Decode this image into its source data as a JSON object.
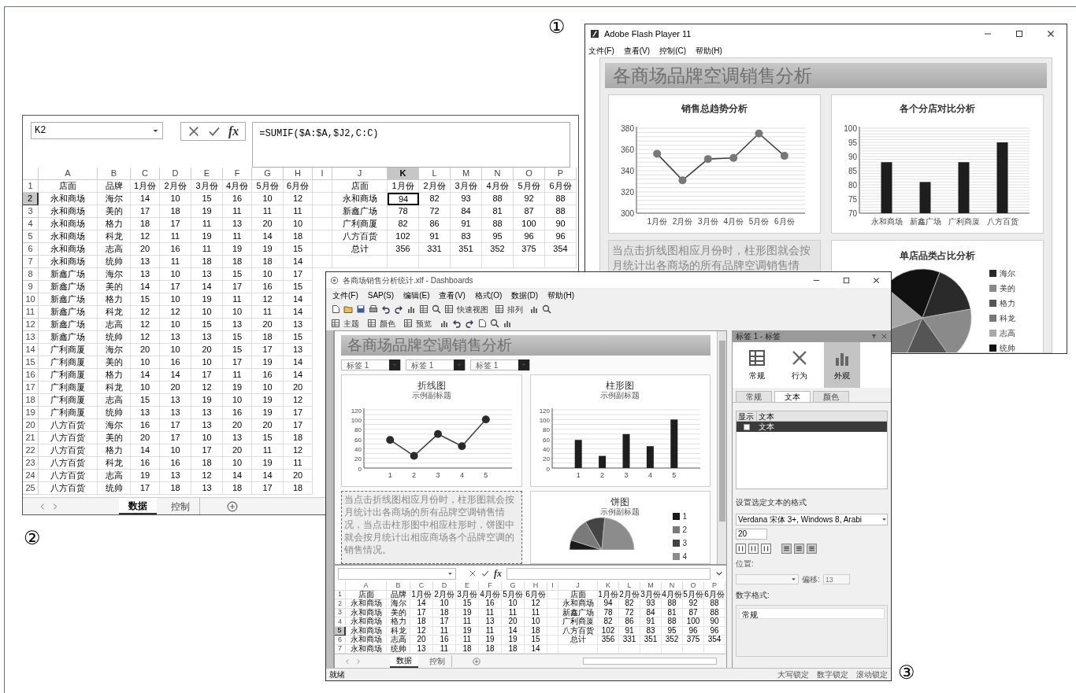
{
  "figure_labels": [
    "①",
    "②",
    "③"
  ],
  "flash_window": {
    "title": "Adobe Flash Player 11",
    "menu": [
      "文件(F)",
      "查看(V)",
      "控制(C)",
      "帮助(H)"
    ],
    "banner": "各商场品牌空调销售分析",
    "line_chart": {
      "chart_data": {
        "type": "line",
        "title": "销售总趋势分析",
        "categories": [
          "1月份",
          "2月份",
          "3月份",
          "4月份",
          "5月份",
          "6月份"
        ],
        "values": [
          356,
          331,
          351,
          352,
          375,
          354
        ],
        "grid": true,
        "marker": true,
        "ylim": [
          300,
          380
        ],
        "yticks": [
          300,
          320,
          340,
          360,
          380
        ]
      }
    },
    "bar_chart": {
      "chart_data": {
        "type": "bar",
        "title": "各个分店对比分析",
        "categories": [
          "永和商场",
          "新鑫广场",
          "广利商厦",
          "八方百货"
        ],
        "values": [
          88,
          81,
          88,
          95
        ],
        "grid": true,
        "ylim": [
          70,
          100
        ],
        "yticks": [
          70,
          75,
          80,
          85,
          90,
          95,
          100
        ]
      }
    },
    "description_lines": [
      "当点击折线图相应月份时，柱形图就会按",
      "月统计出各商场的所有品牌空调销售情"
    ],
    "pie_chart": {
      "title": "单店品类占比分析",
      "legend": [
        {
          "label": "海尔",
          "color": "#2a2a2a"
        },
        {
          "label": "美的",
          "color": "#8a8a8a"
        },
        {
          "label": "格力",
          "color": "#555555"
        },
        {
          "label": "科龙",
          "color": "#777777"
        },
        {
          "label": "志高",
          "color": "#a8a8a8"
        },
        {
          "label": "统帅",
          "color": "#111111"
        }
      ]
    }
  },
  "spreadsheet_window": {
    "name_box": "K2",
    "function_button": "fx",
    "formula": "=SUMIF($A:$A,$J2,C:C)",
    "columns": [
      {
        "label": "A",
        "selected": false
      },
      {
        "label": "B",
        "selected": false
      },
      {
        "label": "C",
        "selected": false
      },
      {
        "label": "D",
        "selected": false
      },
      {
        "label": "E",
        "selected": false
      },
      {
        "label": "F",
        "selected": false
      },
      {
        "label": "G",
        "selected": false
      },
      {
        "label": "H",
        "selected": false
      },
      {
        "label": "I",
        "selected": false
      },
      {
        "label": "J",
        "selected": false
      },
      {
        "label": "K",
        "selected": true
      },
      {
        "label": "L",
        "selected": false
      },
      {
        "label": "M",
        "selected": false
      },
      {
        "label": "N",
        "selected": false
      },
      {
        "label": "O",
        "selected": false
      },
      {
        "label": "P",
        "selected": false
      }
    ],
    "rows": [
      {
        "number": "1",
        "selected": false,
        "data": [
          "店面",
          "品牌",
          "1月份",
          "2月份",
          "3月份",
          "4月份",
          "5月份",
          "6月份"
        ],
        "summary": [
          "店面",
          "1月份",
          "2月份",
          "3月份",
          "4月份",
          "5月份",
          "6月份"
        ]
      },
      {
        "number": "2",
        "selected": true,
        "data": [
          "永和商场",
          "海尔",
          "14",
          "10",
          "15",
          "16",
          "10",
          "12"
        ],
        "summary": [
          "永和商场",
          "94",
          "82",
          "93",
          "88",
          "92",
          "88"
        ]
      },
      {
        "number": "3",
        "selected": false,
        "data": [
          "永和商场",
          "美的",
          "17",
          "18",
          "19",
          "11",
          "11",
          "11"
        ],
        "summary": [
          "新鑫广场",
          "78",
          "72",
          "84",
          "81",
          "87",
          "88"
        ]
      },
      {
        "number": "4",
        "selected": false,
        "data": [
          "永和商场",
          "格力",
          "18",
          "17",
          "11",
          "13",
          "20",
          "10"
        ],
        "summary": [
          "广利商厦",
          "82",
          "86",
          "91",
          "88",
          "100",
          "90"
        ]
      },
      {
        "number": "5",
        "selected": false,
        "data": [
          "永和商场",
          "科龙",
          "12",
          "11",
          "19",
          "11",
          "14",
          "18"
        ],
        "summary": [
          "八方百货",
          "102",
          "91",
          "83",
          "95",
          "96",
          "96"
        ]
      },
      {
        "number": "6",
        "selected": false,
        "data": [
          "永和商场",
          "志高",
          "20",
          "16",
          "11",
          "19",
          "19",
          "15"
        ],
        "summary": [
          "总计",
          "356",
          "331",
          "351",
          "352",
          "375",
          "354"
        ]
      },
      {
        "number": "7",
        "selected": false,
        "data": [
          "永和商场",
          "统帅",
          "13",
          "11",
          "18",
          "18",
          "18",
          "14"
        ]
      },
      {
        "number": "8",
        "selected": false,
        "data": [
          "新鑫广场",
          "海尔",
          "13",
          "10",
          "13",
          "15",
          "10",
          "17"
        ]
      },
      {
        "number": "9",
        "selected": false,
        "data": [
          "新鑫广场",
          "美的",
          "14",
          "17",
          "14",
          "17",
          "16",
          "15"
        ]
      },
      {
        "number": "10",
        "selected": false,
        "data": [
          "新鑫广场",
          "格力",
          "15",
          "10",
          "19",
          "11",
          "12",
          "14"
        ]
      },
      {
        "number": "11",
        "selected": false,
        "data": [
          "新鑫广场",
          "科龙",
          "12",
          "12",
          "10",
          "10",
          "11",
          "14"
        ]
      },
      {
        "number": "12",
        "selected": false,
        "data": [
          "新鑫广场",
          "志高",
          "12",
          "10",
          "15",
          "13",
          "20",
          "13"
        ]
      },
      {
        "number": "13",
        "selected": false,
        "data": [
          "新鑫广场",
          "统帅",
          "12",
          "13",
          "13",
          "15",
          "18",
          "15"
        ]
      },
      {
        "number": "14",
        "selected": false,
        "data": [
          "广利商厦",
          "海尔",
          "20",
          "10",
          "20",
          "15",
          "17",
          "13"
        ]
      },
      {
        "number": "15",
        "selected": false,
        "data": [
          "广利商厦",
          "美的",
          "10",
          "16",
          "10",
          "17",
          "19",
          "14"
        ]
      },
      {
        "number": "16",
        "selected": false,
        "data": [
          "广利商厦",
          "格力",
          "14",
          "14",
          "17",
          "11",
          "16",
          "14"
        ]
      },
      {
        "number": "17",
        "selected": false,
        "data": [
          "广利商厦",
          "科龙",
          "10",
          "20",
          "12",
          "19",
          "10",
          "20"
        ]
      },
      {
        "number": "18",
        "selected": false,
        "data": [
          "广利商厦",
          "志高",
          "15",
          "13",
          "19",
          "10",
          "19",
          "12"
        ]
      },
      {
        "number": "19",
        "selected": false,
        "data": [
          "广利商厦",
          "统帅",
          "13",
          "13",
          "13",
          "16",
          "19",
          "17"
        ]
      },
      {
        "number": "20",
        "selected": false,
        "data": [
          "八方百货",
          "海尔",
          "16",
          "17",
          "13",
          "20",
          "20",
          "17"
        ]
      },
      {
        "number": "21",
        "selected": false,
        "data": [
          "八方百货",
          "美的",
          "20",
          "17",
          "10",
          "13",
          "15",
          "18"
        ]
      },
      {
        "number": "22",
        "selected": false,
        "data": [
          "八方百货",
          "格力",
          "14",
          "10",
          "17",
          "20",
          "11",
          "12"
        ]
      },
      {
        "number": "23",
        "selected": false,
        "data": [
          "八方百货",
          "科龙",
          "16",
          "16",
          "18",
          "10",
          "19",
          "11"
        ]
      },
      {
        "number": "24",
        "selected": false,
        "data": [
          "八方百货",
          "志高",
          "19",
          "13",
          "12",
          "14",
          "14",
          "20"
        ]
      },
      {
        "number": "25",
        "selected": false,
        "data": [
          "八方百货",
          "统帅",
          "17",
          "18",
          "13",
          "18",
          "17",
          "18"
        ]
      }
    ],
    "sheet_tabs": [
      {
        "label": "数据",
        "selected": true
      },
      {
        "label": "控制",
        "selected": false
      }
    ]
  },
  "dashboard_window": {
    "title": "各商场销售分析统计.xlf - Dashboards",
    "menu": [
      "文件(F)",
      "SAP(S)",
      "编辑(E)",
      "查看(V)",
      "格式(O)",
      "数据(D)",
      "帮助(H)"
    ],
    "toolbar_1": [
      "快速视图",
      "排列"
    ],
    "toolbar_2": [
      "主题",
      "颜色",
      "预览"
    ],
    "canvas": {
      "banner": "各商场品牌空调销售分析",
      "selectors": [
        "标签 1",
        "标签 1",
        "标签 1"
      ],
      "line_chart": {
        "subtitle": "示例副标题",
        "chart_data": {
          "type": "line",
          "title": "折线图",
          "categories": [
            "1",
            "2",
            "3",
            "4",
            "5"
          ],
          "values": [
            58,
            25,
            70,
            45,
            100
          ],
          "grid": true,
          "marker": true,
          "ylim": [
            0,
            120
          ],
          "yticks": [
            0,
            20,
            40,
            60,
            80,
            100,
            120
          ]
        }
      },
      "bar_chart": {
        "subtitle": "示例副标题",
        "chart_data": {
          "type": "bar",
          "title": "柱形图",
          "categories": [
            "1",
            "2",
            "3",
            "4",
            "5"
          ],
          "values": [
            58,
            25,
            70,
            45,
            100
          ],
          "grid": true,
          "ylim": [
            0,
            120
          ],
          "yticks": [
            0,
            20,
            40,
            60,
            80,
            100,
            120
          ]
        }
      },
      "text_box": "当点击折线图相应月份时，柱形图就会按月统计出各商场的所有品牌空调销售情况，当点击柱形图中相应柱形时，饼图中就会按月统计出相应商场各个品牌空调的销售情况。",
      "pie_chart": {
        "title": "饼图",
        "subtitle": "示例副标题",
        "legend": [
          {
            "label": "1",
            "color": "#1a1a1a"
          },
          {
            "label": "2",
            "color": "#7a7a7a"
          },
          {
            "label": "3",
            "color": "#444444"
          },
          {
            "label": "4",
            "color": "#8c8c8c"
          }
        ]
      }
    },
    "embedded_sheet": {
      "function_button": "fx",
      "columns": [
        "A",
        "B",
        "C",
        "D",
        "E",
        "F",
        "G",
        "H",
        "I",
        "J",
        "K",
        "L",
        "M",
        "N",
        "O",
        "P"
      ],
      "rows": [
        {
          "number": "1",
          "selected": false,
          "data": [
            "店面",
            "品牌",
            "1月份",
            "2月份",
            "3月份",
            "4月份",
            "5月份",
            "6月份"
          ],
          "summary": [
            "店面",
            "1月份",
            "2月份",
            "3月份",
            "4月份",
            "5月份",
            "6月份"
          ]
        },
        {
          "number": "2",
          "selected": false,
          "data": [
            "永和商场",
            "海尔",
            "14",
            "10",
            "15",
            "16",
            "10",
            "12"
          ],
          "summary": [
            "永和商场",
            "94",
            "82",
            "93",
            "88",
            "92",
            "88"
          ]
        },
        {
          "number": "3",
          "selected": false,
          "data": [
            "永和商场",
            "美的",
            "17",
            "18",
            "19",
            "11",
            "11",
            "11"
          ],
          "summary": [
            "新鑫广场",
            "78",
            "72",
            "84",
            "81",
            "87",
            "88"
          ]
        },
        {
          "number": "4",
          "selected": false,
          "data": [
            "永和商场",
            "格力",
            "18",
            "17",
            "11",
            "13",
            "20",
            "10"
          ],
          "summary": [
            "广利商厦",
            "82",
            "86",
            "91",
            "88",
            "100",
            "90"
          ]
        },
        {
          "number": "5",
          "selected": true,
          "data": [
            "永和商场",
            "科龙",
            "12",
            "11",
            "19",
            "11",
            "14",
            "18"
          ],
          "summary": [
            "八方百货",
            "102",
            "91",
            "83",
            "95",
            "96",
            "96"
          ]
        },
        {
          "number": "6",
          "selected": false,
          "data": [
            "永和商场",
            "志高",
            "20",
            "16",
            "11",
            "19",
            "19",
            "15"
          ],
          "summary": [
            "总计",
            "356",
            "331",
            "351",
            "352",
            "375",
            "354"
          ]
        },
        {
          "number": "7",
          "selected": false,
          "data": [
            "永和商场",
            "统帅",
            "13",
            "11",
            "18",
            "18",
            "18",
            "14"
          ]
        }
      ],
      "sheet_tabs": [
        {
          "label": "数据",
          "selected": true
        },
        {
          "label": "控制",
          "selected": false
        }
      ]
    },
    "properties_panel": {
      "title": "标签 1 - 标签",
      "categories": [
        {
          "label": "常规",
          "selected": false
        },
        {
          "label": "行为",
          "selected": false
        },
        {
          "label": "外观",
          "selected": true
        }
      ],
      "tabs": [
        {
          "label": "常规",
          "selected": false
        },
        {
          "label": "文本",
          "selected": true
        },
        {
          "label": "颜色",
          "selected": false
        }
      ],
      "list_columns": [
        "显示",
        "文本"
      ],
      "list_rows": [
        {
          "label": "文本",
          "checked": false,
          "selected": true
        }
      ],
      "format_heading": "设置选定文本的格式",
      "font": "Verdana 宋体 3+, Windows 8, Arabi",
      "size": "20",
      "position_label": "位置:",
      "offset_label": "偏移:",
      "offset_value": "13",
      "number_format_label": "数字格式:",
      "number_formats": [
        "常规"
      ]
    },
    "status_bar": {
      "left": "就绪",
      "right": [
        "大写锁定",
        "数字锁定",
        "滚动锁定"
      ]
    }
  }
}
